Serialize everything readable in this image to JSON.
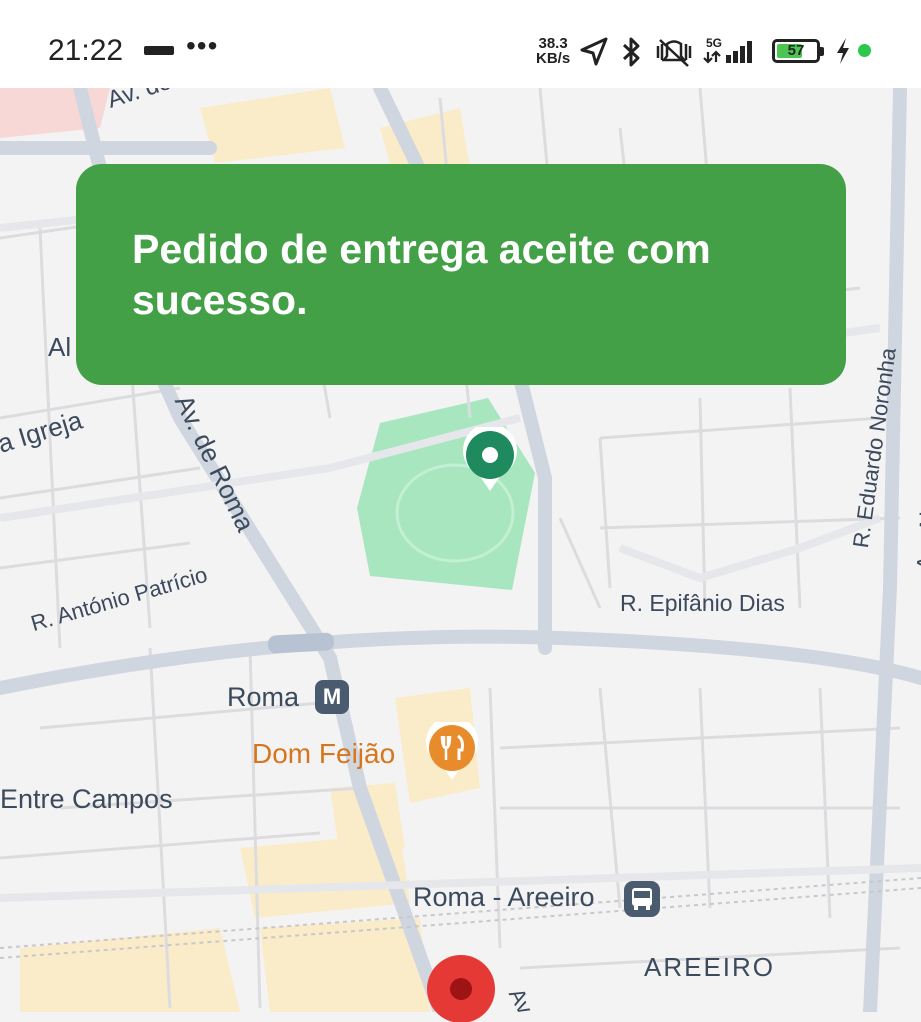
{
  "status_bar": {
    "time": "21:22",
    "more": "•••",
    "speed_value": "38.3",
    "speed_unit": "KB/s",
    "network": "5G",
    "battery": "57"
  },
  "toast": {
    "message": "Pedido de entrega aceite com sucesso."
  },
  "map": {
    "street_labels": {
      "av_top": "Av. do",
      "al": "Al",
      "igreja": "a Igreja",
      "av_roma": "Av. de Roma",
      "antonio_patricio": "R. António Patrício",
      "epifanio_dias": "R. Epifânio Dias",
      "eduardo_noronha": "R. Eduardo Noronha",
      "gago_coutinho": "Av. Alm. Gago Coutinho",
      "av_bottom": "Av"
    },
    "places": {
      "metro_roma": "Roma",
      "metro_icon_letter": "M",
      "restaurant": "Dom Feijão",
      "entre_campos": "Entre Campos",
      "station": "Roma - Areeiro",
      "district": "AREEIRO"
    },
    "colors": {
      "toast": "#43a047",
      "park": "#a8e6c0",
      "destination_marker": "#e53935",
      "origin_marker": "#1e8a5e",
      "restaurant": "#e88c2b"
    }
  }
}
